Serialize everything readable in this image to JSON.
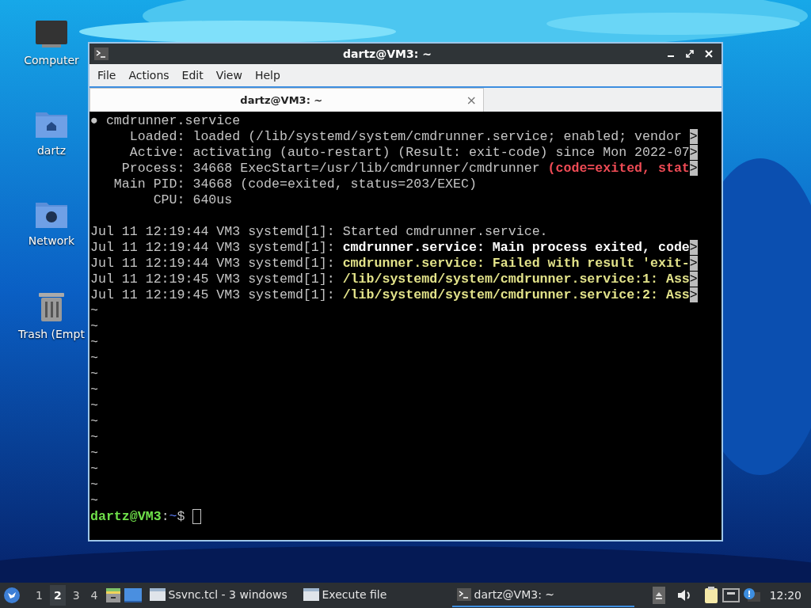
{
  "desktop_icons": [
    {
      "kind": "computer",
      "label": "Computer"
    },
    {
      "kind": "home",
      "label": "dartz"
    },
    {
      "kind": "network",
      "label": "Network"
    },
    {
      "kind": "trash",
      "label": "Trash (Empt"
    }
  ],
  "window": {
    "title": "dartz@VM3: ~",
    "menu": [
      "File",
      "Actions",
      "Edit",
      "View",
      "Help"
    ],
    "tabs": [
      {
        "label": "dartz@VM3: ~",
        "selected": true,
        "close": "×"
      }
    ],
    "terminal": {
      "lines": [
        {
          "kind": "text",
          "segments": [
            {
              "kind": "normal",
              "text": "● cmdrunner.service"
            }
          ]
        },
        {
          "kind": "text",
          "segments": [
            {
              "kind": "normal",
              "text": "     Loaded: loaded (/lib/systemd/system/cmdrunner.service; enabled; vendor "
            },
            {
              "kind": "marker",
              "text": ">"
            }
          ]
        },
        {
          "kind": "text",
          "segments": [
            {
              "kind": "normal",
              "text": "     Active: activating (auto-restart) (Result: exit-code) since Mon 2022-07"
            },
            {
              "kind": "marker",
              "text": ">"
            }
          ]
        },
        {
          "kind": "text",
          "segments": [
            {
              "kind": "normal",
              "text": "    Process: 34668 ExecStart=/usr/lib/cmdrunner/cmdrunner "
            },
            {
              "kind": "red",
              "text": "(code=exited, stat"
            },
            {
              "kind": "marker",
              "text": ">"
            }
          ]
        },
        {
          "kind": "text",
          "segments": [
            {
              "kind": "normal",
              "text": "   Main PID: 34668 (code=exited, status=203/EXEC)"
            }
          ]
        },
        {
          "kind": "text",
          "segments": [
            {
              "kind": "normal",
              "text": "        CPU: 640us"
            }
          ]
        },
        {
          "kind": "blank"
        },
        {
          "kind": "text",
          "segments": [
            {
              "kind": "normal",
              "text": "Jul 11 12:19:44 VM3 systemd[1]: Started cmdrunner.service."
            }
          ]
        },
        {
          "kind": "text",
          "segments": [
            {
              "kind": "normal",
              "text": "Jul 11 12:19:44 VM3 systemd[1]: "
            },
            {
              "kind": "white",
              "text": "cmdrunner.service: Main process exited, code"
            },
            {
              "kind": "marker",
              "text": ">"
            }
          ]
        },
        {
          "kind": "text",
          "segments": [
            {
              "kind": "normal",
              "text": "Jul 11 12:19:44 VM3 systemd[1]: "
            },
            {
              "kind": "yellow",
              "text": "cmdrunner.service: Failed with result 'exit-"
            },
            {
              "kind": "marker",
              "text": ">"
            }
          ]
        },
        {
          "kind": "text",
          "segments": [
            {
              "kind": "normal",
              "text": "Jul 11 12:19:45 VM3 systemd[1]: "
            },
            {
              "kind": "yellow",
              "text": "/lib/systemd/system/cmdrunner.service:1: Ass"
            },
            {
              "kind": "marker",
              "text": ">"
            }
          ]
        },
        {
          "kind": "text",
          "segments": [
            {
              "kind": "normal",
              "text": "Jul 11 12:19:45 VM3 systemd[1]: "
            },
            {
              "kind": "yellow",
              "text": "/lib/systemd/system/cmdrunner.service:2: Ass"
            },
            {
              "kind": "marker",
              "text": ">"
            }
          ]
        },
        {
          "kind": "text",
          "segments": [
            {
              "kind": "normal",
              "text": "~"
            }
          ]
        },
        {
          "kind": "text",
          "segments": [
            {
              "kind": "normal",
              "text": "~"
            }
          ]
        },
        {
          "kind": "text",
          "segments": [
            {
              "kind": "normal",
              "text": "~"
            }
          ]
        },
        {
          "kind": "text",
          "segments": [
            {
              "kind": "normal",
              "text": "~"
            }
          ]
        },
        {
          "kind": "text",
          "segments": [
            {
              "kind": "normal",
              "text": "~"
            }
          ]
        },
        {
          "kind": "text",
          "segments": [
            {
              "kind": "normal",
              "text": "~"
            }
          ]
        },
        {
          "kind": "text",
          "segments": [
            {
              "kind": "normal",
              "text": "~"
            }
          ]
        },
        {
          "kind": "text",
          "segments": [
            {
              "kind": "normal",
              "text": "~"
            }
          ]
        },
        {
          "kind": "text",
          "segments": [
            {
              "kind": "normal",
              "text": "~"
            }
          ]
        },
        {
          "kind": "text",
          "segments": [
            {
              "kind": "normal",
              "text": "~"
            }
          ]
        },
        {
          "kind": "text",
          "segments": [
            {
              "kind": "normal",
              "text": "~"
            }
          ]
        },
        {
          "kind": "text",
          "segments": [
            {
              "kind": "normal",
              "text": "~"
            }
          ]
        },
        {
          "kind": "text",
          "segments": [
            {
              "kind": "normal",
              "text": "~"
            }
          ]
        }
      ],
      "prompt": [
        {
          "kind": "green",
          "text": "dartz@VM3"
        },
        {
          "kind": "normal",
          "text": ":"
        },
        {
          "kind": "blue",
          "text": "~"
        },
        {
          "kind": "normal",
          "text": "$ "
        }
      ]
    }
  },
  "taskbar": {
    "workspaces": [
      {
        "label": "1",
        "selected": false
      },
      {
        "label": "2",
        "selected": true
      },
      {
        "label": "3",
        "selected": false
      },
      {
        "label": "4",
        "selected": false
      }
    ],
    "tasks": [
      {
        "kind": "window",
        "label": "Ssvnc.tcl - 3 windows",
        "selected": false
      },
      {
        "kind": "window",
        "label": "Execute file",
        "selected": false
      },
      {
        "kind": "terminal",
        "label": "dartz@VM3: ~",
        "selected": true
      }
    ],
    "clock": "12:20"
  }
}
